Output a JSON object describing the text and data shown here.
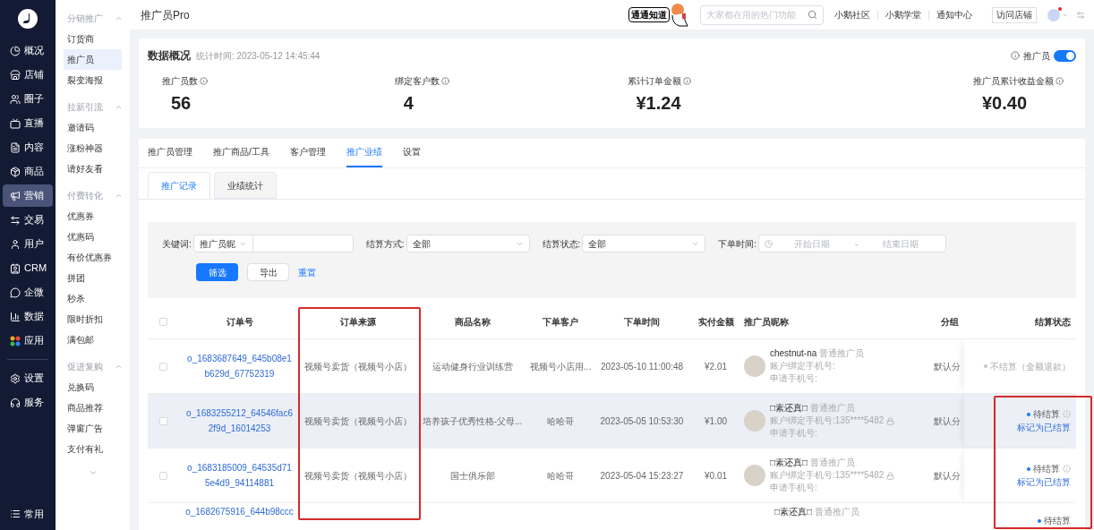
{
  "nav": {
    "items": [
      {
        "label": "概况",
        "selected": false
      },
      {
        "label": "店铺",
        "selected": false
      },
      {
        "label": "圈子",
        "selected": false
      },
      {
        "label": "直播",
        "selected": false
      },
      {
        "label": "内容",
        "selected": false
      },
      {
        "label": "商品",
        "selected": false
      },
      {
        "label": "营销",
        "selected": true
      },
      {
        "label": "交易",
        "selected": false
      },
      {
        "label": "用户",
        "selected": false
      },
      {
        "label": "CRM",
        "selected": false
      },
      {
        "label": "企微",
        "selected": false
      },
      {
        "label": "数据",
        "selected": false
      },
      {
        "label": "应用",
        "selected": false
      }
    ],
    "bottom_items": [
      {
        "label": "设置",
        "selected": false
      },
      {
        "label": "服务",
        "selected": false
      }
    ],
    "footer": {
      "label": "常用"
    }
  },
  "submenu": [
    {
      "title": "分销推广",
      "expanded": true,
      "items": [
        {
          "label": "订货商",
          "selected": false
        },
        {
          "label": "推广员",
          "selected": true
        },
        {
          "label": "裂变海报",
          "selected": false
        }
      ]
    },
    {
      "title": "拉新引流",
      "expanded": true,
      "items": [
        {
          "label": "邀请码",
          "selected": false
        },
        {
          "label": "涨粉神器",
          "selected": false
        },
        {
          "label": "请好友看",
          "selected": false
        }
      ]
    },
    {
      "title": "付费转化",
      "expanded": true,
      "items": [
        {
          "label": "优惠券",
          "selected": false
        },
        {
          "label": "优惠码",
          "selected": false
        },
        {
          "label": "有价优惠券",
          "selected": false
        },
        {
          "label": "拼团",
          "selected": false
        },
        {
          "label": "秒杀",
          "selected": false
        },
        {
          "label": "限时折扣",
          "selected": false
        },
        {
          "label": "满包邮",
          "selected": false
        }
      ]
    },
    {
      "title": "促进复购",
      "expanded": true,
      "items": [
        {
          "label": "兑换码",
          "selected": false
        },
        {
          "label": "商品推荐",
          "selected": false
        },
        {
          "label": "弹窗广告",
          "selected": false
        },
        {
          "label": "支付有礼",
          "selected": false
        }
      ]
    }
  ],
  "header": {
    "title": "推广员Pro",
    "mascot_label": "通通知道",
    "search": {
      "placeholder": "大家都在用的热门功能"
    },
    "links": [
      "小鹅社区",
      "小鹅学堂",
      "通知中心"
    ],
    "visit_button": "访问店铺",
    "notification_dot": true
  },
  "overview": {
    "title": "数据概况",
    "timestamp": "统计时间: 2023-05-12 14:45:44",
    "toggle": {
      "label": "推广员",
      "on": true
    },
    "stats": [
      {
        "label": "推广员数",
        "value": "56"
      },
      {
        "label": "绑定客户数",
        "value": "4"
      },
      {
        "label": "累计订单金额",
        "value": "¥1.24"
      },
      {
        "label": "推广员累计收益金额",
        "value": "¥0.40"
      }
    ]
  },
  "tabs": [
    {
      "label": "推广员管理",
      "selected": false
    },
    {
      "label": "推广商品/工具",
      "selected": false
    },
    {
      "label": "客户管理",
      "selected": false
    },
    {
      "label": "推广业绩",
      "selected": true
    },
    {
      "label": "设置",
      "selected": false
    }
  ],
  "subtabs": [
    {
      "label": "推广记录",
      "selected": true
    },
    {
      "label": "业绩统计",
      "selected": false
    }
  ],
  "filters": {
    "keyword": {
      "label": "关键词:",
      "type": "推广员昵"
    },
    "method": {
      "label": "结算方式:",
      "value": "全部"
    },
    "status": {
      "label": "结算状态:",
      "value": "全部"
    },
    "time": {
      "label": "下单时间:",
      "start": "开始日期",
      "separator": "-",
      "end": "结束日期"
    },
    "buttons": {
      "filter": "筛选",
      "export": "导出",
      "reset": "重置"
    }
  },
  "table": {
    "all_checked": false,
    "columns": [
      "订单号",
      "订单来源",
      "商品名称",
      "下单客户",
      "下单时间",
      "实付金额",
      "推广员昵称",
      "分组",
      "结算状态"
    ],
    "rows": [
      {
        "checked": false,
        "highlighted": false,
        "order_no": "o_1683687649_645b08e1b629d_67752319",
        "source": "视频号卖货（视频号小店）",
        "product": "运动健身行业训练营",
        "customer": "视频号小店用...",
        "time": "2023-05-10 11:00:48",
        "amount": "¥2.01",
        "promoter": "chestnut-na",
        "role": "普通推广员",
        "bound_phone": "账户绑定手机号:",
        "locked": false,
        "apply_phone": "申请手机号:",
        "group": "默认分",
        "status": "不结算（全额退款）",
        "pending": false
      },
      {
        "checked": false,
        "highlighted": true,
        "order_no": "o_1683255212_64546fac62f9d_16014253",
        "source": "视频号卖货（视频号小店）",
        "product": "培养孩子优秀性格-父母...",
        "customer": "哈哈哥",
        "time": "2023-05-05 10:53:30",
        "amount": "¥1.00",
        "promoter": "□素还真□",
        "role": "普通推广员",
        "bound_phone": "账户绑定手机号:135****5482",
        "locked": true,
        "apply_phone": "申请手机号:",
        "group": "默认分",
        "status": "待结算",
        "pending": true,
        "action": "标记为已结算"
      },
      {
        "checked": false,
        "highlighted": false,
        "order_no": "o_1683185009_64535d715e4d9_94114881",
        "source": "视频号卖货（视频号小店）",
        "product": "国士俱乐部",
        "customer": "哈哈哥",
        "time": "2023-05-04 15:23:27",
        "amount": "¥0.01",
        "promoter": "□素还真□",
        "role": "普通推广员",
        "bound_phone": "账户绑定手机号:135****5482",
        "locked": true,
        "apply_phone": "申请手机号:",
        "group": "默认分",
        "status": "待结算",
        "pending": true,
        "action": "标记为已结算"
      }
    ],
    "partial_row": {
      "order_no": "o_1682675916_644b98ccc",
      "promoter": "□素还真□",
      "role": "普通推广员",
      "status": "待结算"
    }
  }
}
